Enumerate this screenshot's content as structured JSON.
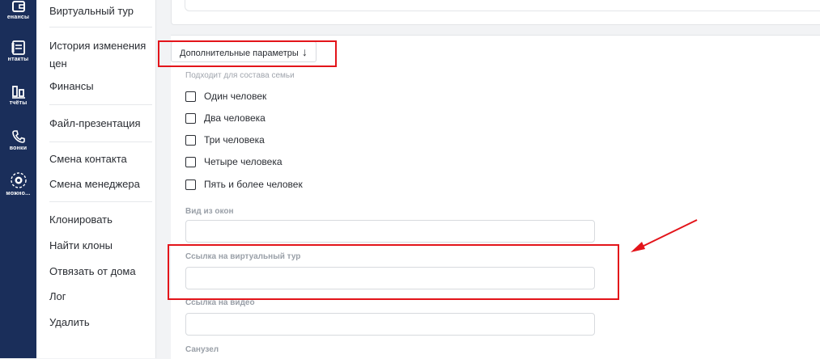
{
  "rail": {
    "items": [
      {
        "label": "енансы",
        "icon": "wallet-icon"
      },
      {
        "label": "нтакты",
        "icon": "contacts-icon"
      },
      {
        "label": "тчёты",
        "icon": "reports-icon"
      },
      {
        "label": "вонки",
        "icon": "phone-icon"
      },
      {
        "label": "можно...",
        "icon": "settings-icon"
      }
    ]
  },
  "menu": {
    "items": [
      "Виртуальный тур",
      "История изменения цен",
      "Финансы",
      "Файл-презентация",
      "Смена контакта",
      "Смена менеджера",
      "Клонировать",
      "Найти клоны",
      "Отвязать от дома",
      "Лог",
      "Удалить"
    ]
  },
  "form": {
    "advanced_button": "Дополнительные параметры",
    "advanced_arrow": "↓",
    "family_label": "Подходит для состава семьи",
    "family_options": [
      "Один человек",
      "Два человека",
      "Три человека",
      "Четыре человека",
      "Пять и более человек"
    ],
    "view_label": "Вид из окон",
    "tour_label": "Ссылка на виртуальный тур",
    "video_label": "Ссылка на видео",
    "bathroom_label": "Санузел"
  },
  "colors": {
    "rail": "#1a2e5a",
    "highlight": "#e3141a"
  }
}
